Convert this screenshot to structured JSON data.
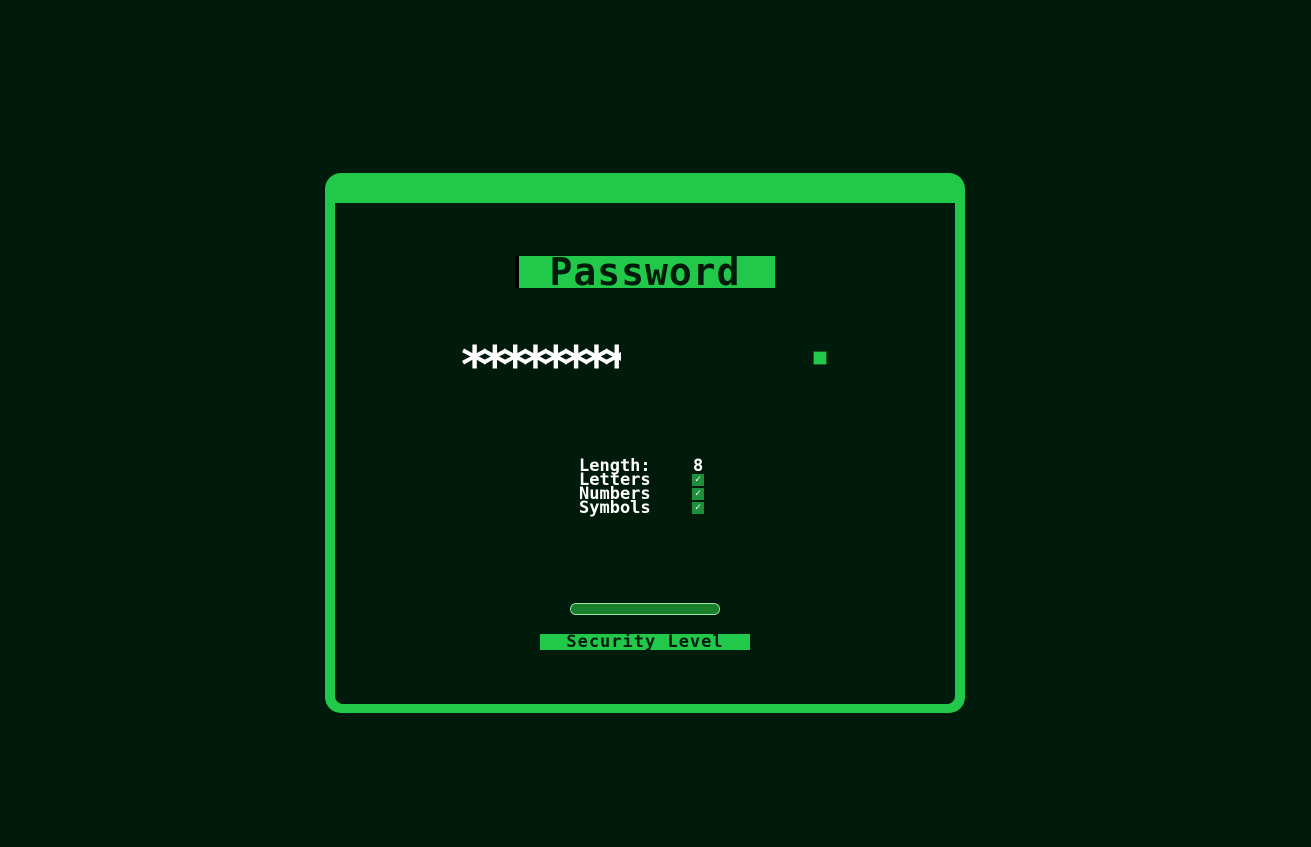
{
  "window": {
    "title": "Password",
    "accent_color": "#21c84a",
    "background_color": "#001a0b"
  },
  "password": {
    "masked_value": "********"
  },
  "stats": {
    "length_label": "Length:",
    "length_value": "8",
    "letters_label": "Letters",
    "letters_check": "✓",
    "numbers_label": "Numbers",
    "numbers_check": "✓",
    "symbols_label": "Symbols",
    "symbols_check": "✓"
  },
  "security": {
    "label": "Security Level",
    "level_fraction": 1.0,
    "bar_color": "#1a7f2b"
  }
}
